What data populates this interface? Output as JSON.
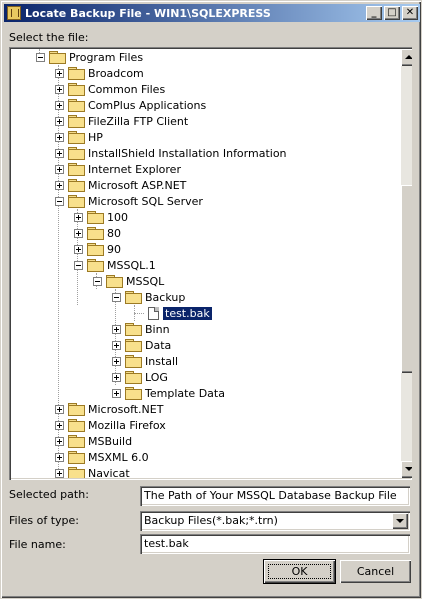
{
  "window": {
    "title": "Locate Backup File - WIN1\\SQLEXPRESS",
    "minimize_glyph": "_",
    "maximize_glyph": "□",
    "close_glyph": "✕"
  },
  "select_file_label": "Select the file:",
  "tree": {
    "items": [
      {
        "label": "Program Files",
        "expander": "minus"
      },
      {
        "label": "Broadcom",
        "expander": "plus"
      },
      {
        "label": "Common Files",
        "expander": "plus"
      },
      {
        "label": "ComPlus Applications",
        "expander": "plus"
      },
      {
        "label": "FileZilla FTP Client",
        "expander": "plus"
      },
      {
        "label": "HP",
        "expander": "plus"
      },
      {
        "label": "InstallShield Installation Information",
        "expander": "plus"
      },
      {
        "label": "Internet Explorer",
        "expander": "plus"
      },
      {
        "label": "Microsoft ASP.NET",
        "expander": "plus"
      },
      {
        "label": "Microsoft SQL Server",
        "expander": "minus"
      },
      {
        "label": "100",
        "expander": "plus"
      },
      {
        "label": "80",
        "expander": "plus"
      },
      {
        "label": "90",
        "expander": "plus"
      },
      {
        "label": "MSSQL.1",
        "expander": "minus"
      },
      {
        "label": "MSSQL",
        "expander": "minus"
      },
      {
        "label": "Backup",
        "expander": "minus"
      },
      {
        "label": "test.bak",
        "expander": "none",
        "selected": true
      },
      {
        "label": "Binn",
        "expander": "plus"
      },
      {
        "label": "Data",
        "expander": "plus"
      },
      {
        "label": "Install",
        "expander": "plus"
      },
      {
        "label": "LOG",
        "expander": "plus"
      },
      {
        "label": "Template Data",
        "expander": "plus"
      },
      {
        "label": "Microsoft.NET",
        "expander": "plus"
      },
      {
        "label": "Mozilla Firefox",
        "expander": "plus"
      },
      {
        "label": "MSBuild",
        "expander": "plus"
      },
      {
        "label": "MSXML 6.0",
        "expander": "plus"
      },
      {
        "label": "Navicat",
        "expander": "plus"
      }
    ]
  },
  "selected_path": {
    "label": "Selected path:",
    "value": "The Path of Your MSSQL Database Backup File"
  },
  "files_of_type": {
    "label": "Files of type:",
    "value": "Backup Files(*.bak;*.trn)"
  },
  "file_name": {
    "label": "File name:",
    "value": "test.bak"
  },
  "buttons": {
    "ok": "OK",
    "cancel": "Cancel"
  },
  "colors": {
    "titlebar_start": "#0a246a",
    "titlebar_end": "#a6caf0",
    "dialog_face": "#d4d0c8",
    "selection": "#0a246a"
  }
}
